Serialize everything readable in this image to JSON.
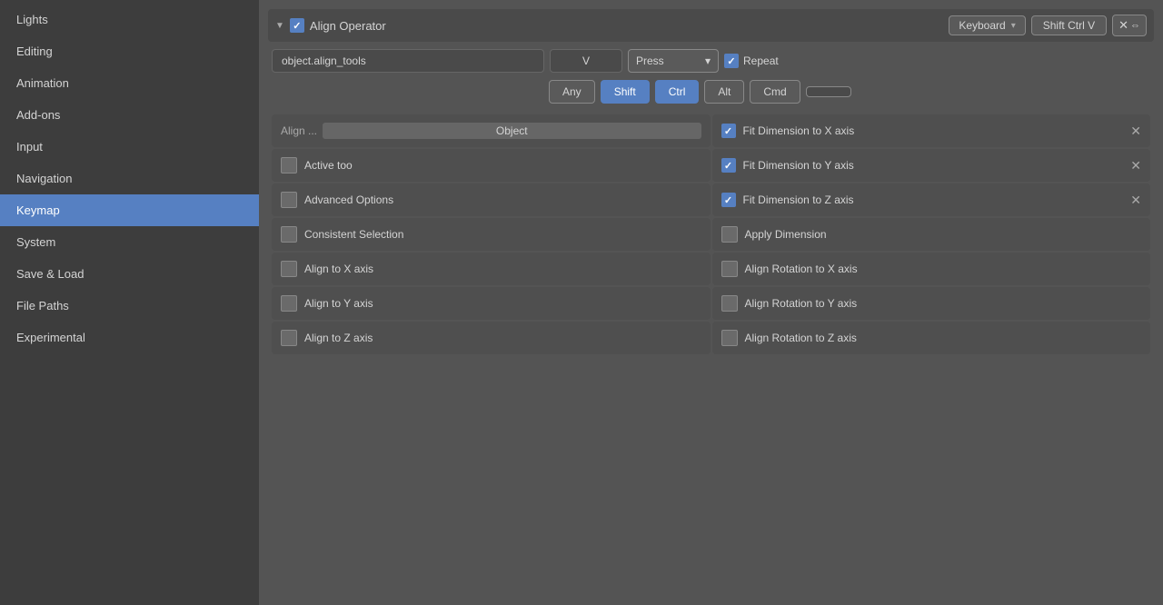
{
  "sidebar": {
    "items": [
      {
        "id": "lights",
        "label": "Lights",
        "active": false
      },
      {
        "id": "editing",
        "label": "Editing",
        "active": false
      },
      {
        "id": "animation",
        "label": "Animation",
        "active": false
      },
      {
        "id": "addons",
        "label": "Add-ons",
        "active": false
      },
      {
        "id": "input",
        "label": "Input",
        "active": false
      },
      {
        "id": "navigation",
        "label": "Navigation",
        "active": false
      },
      {
        "id": "keymap",
        "label": "Keymap",
        "active": true
      },
      {
        "id": "system",
        "label": "System",
        "active": false
      },
      {
        "id": "saveload",
        "label": "Save & Load",
        "active": false
      },
      {
        "id": "filepaths",
        "label": "File Paths",
        "active": false
      },
      {
        "id": "experimental",
        "label": "Experimental",
        "active": false
      }
    ]
  },
  "operator": {
    "label": "Align Operator",
    "keyboard_label": "Keyboard",
    "shortcut_label": "Shift Ctrl V",
    "operator_id": "object.align_tools",
    "key": "V",
    "type": "Press",
    "repeat_label": "Repeat"
  },
  "modifiers": {
    "any_label": "Any",
    "shift_label": "Shift",
    "ctrl_label": "Ctrl",
    "alt_label": "Alt",
    "cmd_label": "Cmd"
  },
  "left_options": [
    {
      "id": "align-object",
      "prefix": "Align ...",
      "value": "Object",
      "type": "align-input"
    },
    {
      "id": "active-too",
      "label": "Active too",
      "checked": false
    },
    {
      "id": "advanced-options",
      "label": "Advanced Options",
      "checked": false
    },
    {
      "id": "consistent-selection",
      "label": "Consistent Selection",
      "checked": false
    },
    {
      "id": "align-x",
      "label": "Align to X axis",
      "checked": false
    },
    {
      "id": "align-y",
      "label": "Align to Y axis",
      "checked": false
    },
    {
      "id": "align-z",
      "label": "Align to Z axis",
      "checked": false
    }
  ],
  "right_options": [
    {
      "id": "fit-dim-x",
      "label": "Fit Dimension to X axis",
      "checked": true,
      "has_close": true
    },
    {
      "id": "fit-dim-y",
      "label": "Fit Dimension to Y axis",
      "checked": true,
      "has_close": true
    },
    {
      "id": "fit-dim-z",
      "label": "Fit Dimension to Z axis",
      "checked": true,
      "has_close": true
    },
    {
      "id": "apply-dimension",
      "label": "Apply  Dimension",
      "checked": false,
      "has_close": false
    },
    {
      "id": "align-rot-x",
      "label": "Align Rotation to X axis",
      "checked": false,
      "has_close": false
    },
    {
      "id": "align-rot-y",
      "label": "Align Rotation to Y axis",
      "checked": false,
      "has_close": false
    },
    {
      "id": "align-rot-z",
      "label": "Align Rotation to Z axis",
      "checked": false,
      "has_close": false
    }
  ]
}
